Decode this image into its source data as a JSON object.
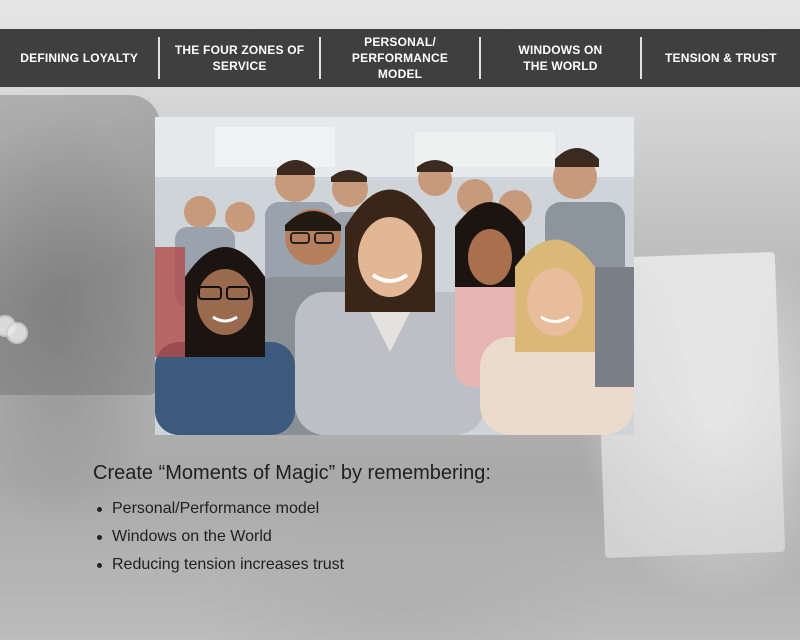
{
  "nav": {
    "items": [
      {
        "label": "DEFINING LOYALTY"
      },
      {
        "label": "THE FOUR ZONES OF\nSERVICE"
      },
      {
        "label": "PERSONAL/\nPERFORMANCE MODEL"
      },
      {
        "label": "WINDOWS ON\nTHE WORLD"
      },
      {
        "label": "TENSION & TRUST"
      }
    ],
    "background": "#3f3f3f",
    "text_color": "#ffffff"
  },
  "photo": {
    "description_icon": "group-photo"
  },
  "content": {
    "headline": "Create “Moments of Magic” by remembering:",
    "bullets": [
      "Personal/Performance model",
      "Windows on the World",
      "Reducing tension increases trust"
    ]
  }
}
